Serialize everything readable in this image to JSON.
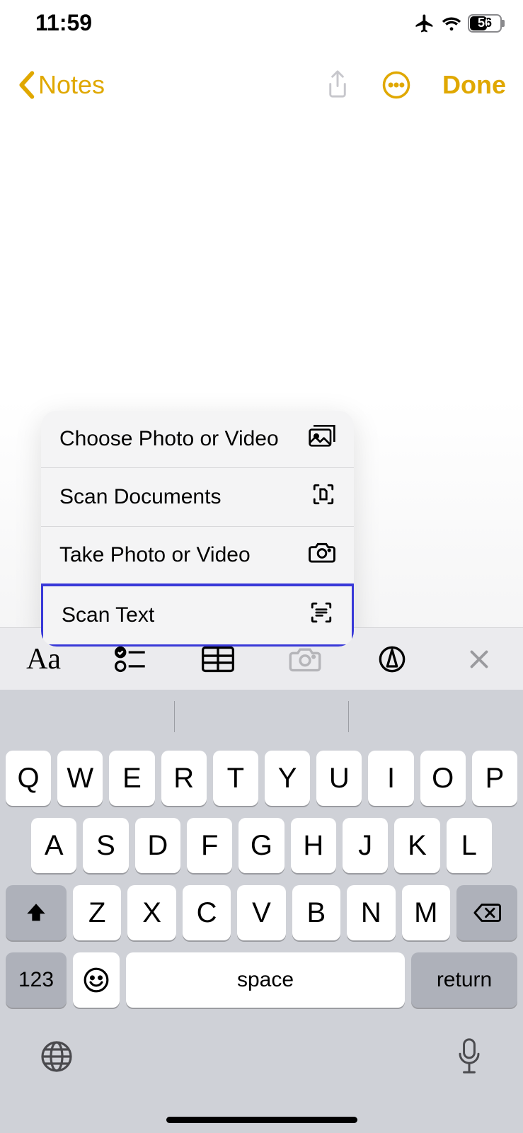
{
  "status": {
    "time": "11:59",
    "battery": "56"
  },
  "nav": {
    "back_label": "Notes",
    "done_label": "Done"
  },
  "popover": {
    "items": [
      {
        "label": "Choose Photo or Video",
        "icon": "gallery-icon"
      },
      {
        "label": "Scan Documents",
        "icon": "scan-doc-icon"
      },
      {
        "label": "Take Photo or Video",
        "icon": "camera-icon"
      },
      {
        "label": "Scan Text",
        "icon": "scan-text-icon"
      }
    ],
    "highlighted_index": 3
  },
  "toolbar": {
    "aa_label": "Aa"
  },
  "keyboard": {
    "row1": [
      "Q",
      "W",
      "E",
      "R",
      "T",
      "Y",
      "U",
      "I",
      "O",
      "P"
    ],
    "row2": [
      "A",
      "S",
      "D",
      "F",
      "G",
      "H",
      "J",
      "K",
      "L"
    ],
    "row3": [
      "Z",
      "X",
      "C",
      "V",
      "B",
      "N",
      "M"
    ],
    "num_label": "123",
    "space_label": "space",
    "return_label": "return"
  }
}
